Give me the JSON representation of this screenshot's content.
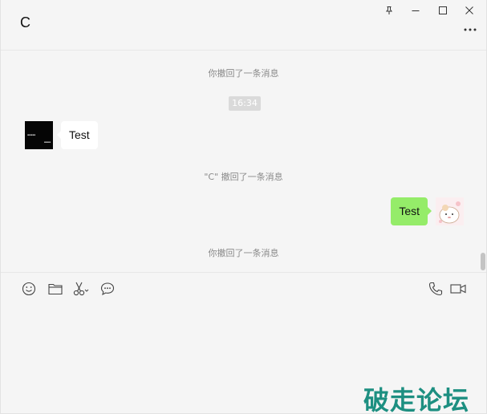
{
  "chat": {
    "title": "C"
  },
  "window_controls": {
    "pin": "pin-icon",
    "minimize": "minimize-icon",
    "maximize": "maximize-icon",
    "close": "close-icon",
    "more": "more-icon"
  },
  "messages": {
    "system_1": "你撤回了一条消息",
    "timestamp": "16:34",
    "left_bubble": "Test",
    "system_2": "\"C\" 撤回了一条消息",
    "right_bubble": "Test",
    "system_3": "你撤回了一条消息"
  },
  "toolbar": {
    "emoji": "emoji-icon",
    "file": "folder-icon",
    "screenshot": "scissors-icon",
    "chat_history": "chat-bubble-icon",
    "voice_call": "phone-icon",
    "video_call": "video-icon"
  },
  "watermark": {
    "text": "破走论坛",
    "color": "#1d8f81"
  },
  "colors": {
    "sent_bubble": "#95ec69",
    "received_bubble": "#ffffff",
    "background": "#f5f5f5"
  }
}
